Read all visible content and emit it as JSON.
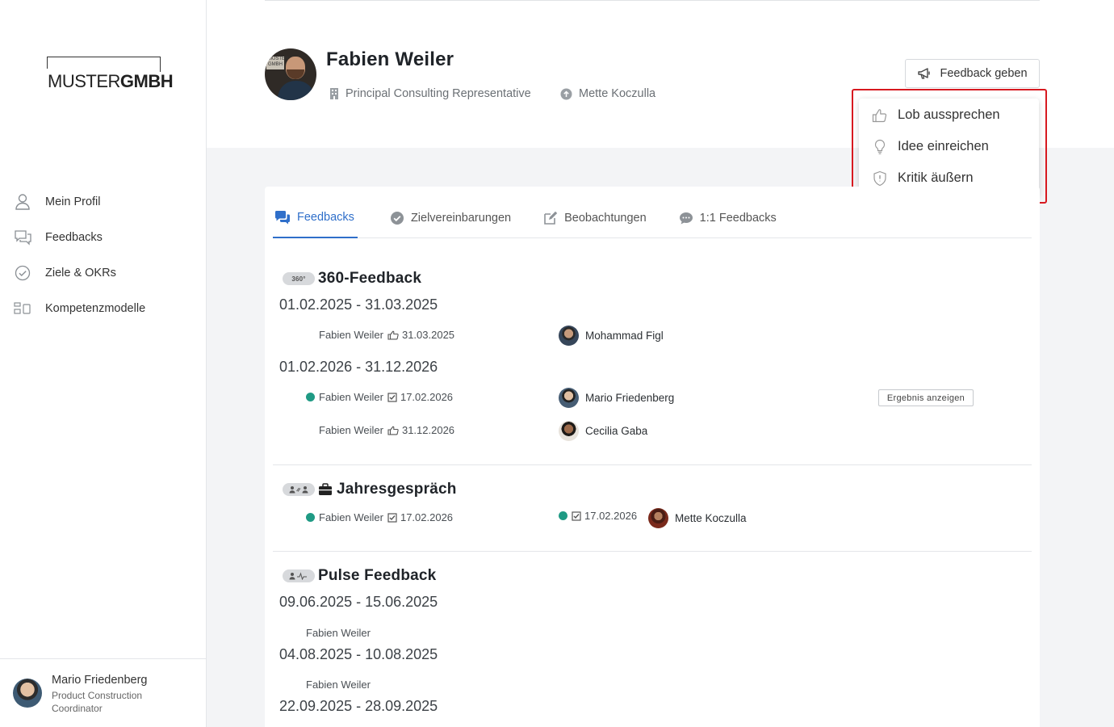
{
  "sidebar": {
    "logo_light": "MUSTER",
    "logo_bold": "GMBH",
    "items": [
      {
        "label": "Mein Profil",
        "icon": "user-icon"
      },
      {
        "label": "Feedbacks",
        "icon": "chat-bubbles-icon"
      },
      {
        "label": "Ziele & OKRs",
        "icon": "check-circle-icon"
      },
      {
        "label": "Kompetenzmodelle",
        "icon": "model-icon"
      }
    ],
    "current_user": {
      "name": "Mario Friedenberg",
      "role": "Product Construction Coordinator"
    }
  },
  "profile": {
    "name": "Fabien Weiler",
    "position": "Principal Consulting Representative",
    "manager": "Mette Koczulla",
    "feedback_button": "Feedback geben"
  },
  "dropdown": {
    "items": [
      {
        "label": "Lob aussprechen",
        "icon": "thumbs-up-icon"
      },
      {
        "label": "Idee einreichen",
        "icon": "lightbulb-icon"
      },
      {
        "label": "Kritik äußern",
        "icon": "shield-icon"
      }
    ],
    "highlight_color": "#d71920"
  },
  "tabs": [
    {
      "label": "Feedbacks",
      "icon": "chat-bubbles-icon",
      "active": true
    },
    {
      "label": "Zielvereinbarungen",
      "icon": "check-circle-icon",
      "active": false
    },
    {
      "label": "Beobachtungen",
      "icon": "edit-icon",
      "active": false
    },
    {
      "label": "1:1 Feedbacks",
      "icon": "comment-dots-icon",
      "active": false
    }
  ],
  "feedback360": {
    "badge": "360°",
    "title": "360-Feedback",
    "periods": [
      {
        "range": "01.02.2025 - 31.03.2025",
        "entries": [
          {
            "subject": "Fabien Weiler",
            "date": "31.03.2025",
            "status_icon": "hand-point-icon",
            "reviewer": "Mohammad Figl",
            "done": false
          }
        ]
      },
      {
        "range": "01.02.2026 - 31.12.2026",
        "entries": [
          {
            "subject": "Fabien Weiler",
            "date": "17.02.2026",
            "status_icon": "checked-box-icon",
            "reviewer": "Mario Friedenberg",
            "done": true,
            "action": "Ergebnis anzeigen"
          },
          {
            "subject": "Fabien Weiler",
            "date": "31.12.2026",
            "status_icon": "hand-point-icon",
            "reviewer": "Cecilia Gaba",
            "done": false
          }
        ]
      }
    ]
  },
  "jahresgespraech": {
    "title": "Jahresgespräch",
    "subject": "Fabien Weiler",
    "subject_date": "17.02.2026",
    "reviewer_date": "17.02.2026",
    "reviewer": "Mette Koczulla"
  },
  "pulse": {
    "title": "Pulse Feedback",
    "periods": [
      {
        "range": "09.06.2025 - 15.06.2025",
        "name": "Fabien Weiler"
      },
      {
        "range": "04.08.2025 - 10.08.2025",
        "name": "Fabien Weiler"
      },
      {
        "range": "22.09.2025 - 28.09.2025",
        "name": ""
      }
    ]
  },
  "colors": {
    "accent": "#2f6fca",
    "done": "#1f9a84"
  }
}
